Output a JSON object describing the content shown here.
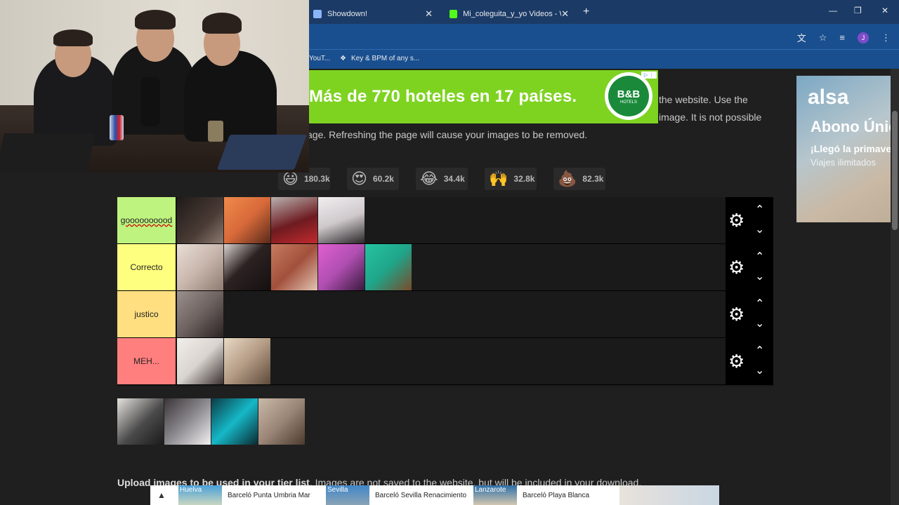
{
  "browser": {
    "tabs": [
      {
        "title": "Showdown!",
        "close": "✕",
        "favicon_color": "#8ab4f8"
      },
      {
        "title": "Mi_coleguita_y_yo Videos - Wa",
        "close": "✕",
        "favicon_color": "#53fc18"
      }
    ],
    "new_tab": "+",
    "window_controls": {
      "minimize": "—",
      "restore": "❐",
      "close": "✕"
    },
    "profile_initial": "J",
    "bookmarks": [
      {
        "label": "YouT..."
      },
      {
        "label": "Key & BPM of any s..."
      }
    ]
  },
  "page": {
    "intro_lines": [
      "the website. Use the",
      "image. It is not possible",
      "age. Refreshing the page will cause your images to be removed."
    ],
    "ad_top": {
      "headline": "Más de 770 hoteles en 17 países.",
      "logo_main": "B&B",
      "logo_sub": "HOTELS"
    },
    "ad_right": {
      "logo": "alsa",
      "line1": "Abono Únic",
      "line2": "¡Llegó la primave",
      "line3": "Viajes ilimitados"
    },
    "reactions": [
      {
        "icon": "😃",
        "count": "180.3k"
      },
      {
        "icon": "😍",
        "count": "60.2k"
      },
      {
        "icon": "😂",
        "count": "34.4k"
      },
      {
        "icon": "🙌",
        "count": "32.8k"
      },
      {
        "icon": "💩",
        "count": "82.3k"
      }
    ],
    "tiers": [
      {
        "label": "goooooooood",
        "color": "#bff37f",
        "images": [
          "#3b2f2c",
          "#d86a3a",
          "#8e1f24",
          "#e9e4e6"
        ]
      },
      {
        "label": "Correcto",
        "color": "#ffff7f",
        "images": [
          "#c9b7ad",
          "#2c2222",
          "#a2503c",
          "#b04fb2",
          "#1fa58a"
        ]
      },
      {
        "label": "justico",
        "color": "#ffdf80",
        "images": [
          "#6d6260"
        ]
      },
      {
        "label": "MEH...",
        "color": "#ff7f7e",
        "images": [
          "#d9d4cf",
          "#b39b84"
        ]
      }
    ],
    "tier_controls": {
      "gear": "⚙",
      "up": "⌃",
      "down": "⌄"
    },
    "pool_images": [
      "#4a4a4a",
      "#8c8a8f",
      "#16b8c8",
      "#9b8677"
    ],
    "upload_bold": "Upload images to be used in your tier list",
    "upload_rest": ". Images are not saved to the website, but will be included in your download.",
    "ad_bottom": {
      "arrow": "▲",
      "items": [
        {
          "tag": "Huelva",
          "text": "Barceló Punta Umbria Mar"
        },
        {
          "tag": "Sevilla",
          "text": "Barceló Sevilla Renacimiento"
        },
        {
          "tag": "Lanzarote",
          "text": "Barceló Playa Blanca"
        }
      ]
    }
  }
}
